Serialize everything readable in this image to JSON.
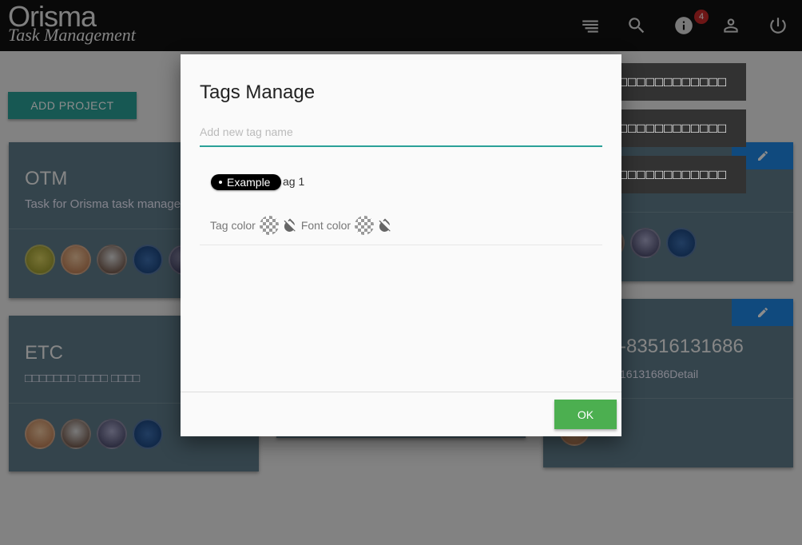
{
  "app": {
    "brand": "Orisma",
    "subtitle": "Task Management",
    "notification_count": "4"
  },
  "toolbar": {
    "icons": [
      "notes-icon",
      "search-icon",
      "info-icon",
      "account-icon",
      "power-icon"
    ]
  },
  "page": {
    "add_project_label": "ADD PROJECT",
    "cards": [
      {
        "title": "OTM",
        "description": "Task for Orisma task manage"
      },
      {
        "title": "ETC",
        "description": "□□□□□□□ □□□□ □□□□"
      },
      {
        "title": "-83516131686",
        "description": "16131686Detail"
      }
    ]
  },
  "toasts": [
    "□□□□□□□□□□□□□□□□",
    "□□□□□□□□□□□□□□□□",
    "□□□□□□□□□□□□□□□□"
  ],
  "dialog": {
    "title": "Tags Manage",
    "input_placeholder": "Add new tag name",
    "chip_label": "Example",
    "tag_name": "ag 1",
    "tag_color_label": "Tag color",
    "font_color_label": "Font color",
    "ok_label": "OK"
  },
  "colors": {
    "topbar": "#111111",
    "accent": "#2aa198",
    "card": "#607d8b",
    "edit": "#1e88e5",
    "ok": "#4caf50",
    "badge": "#c62828"
  }
}
